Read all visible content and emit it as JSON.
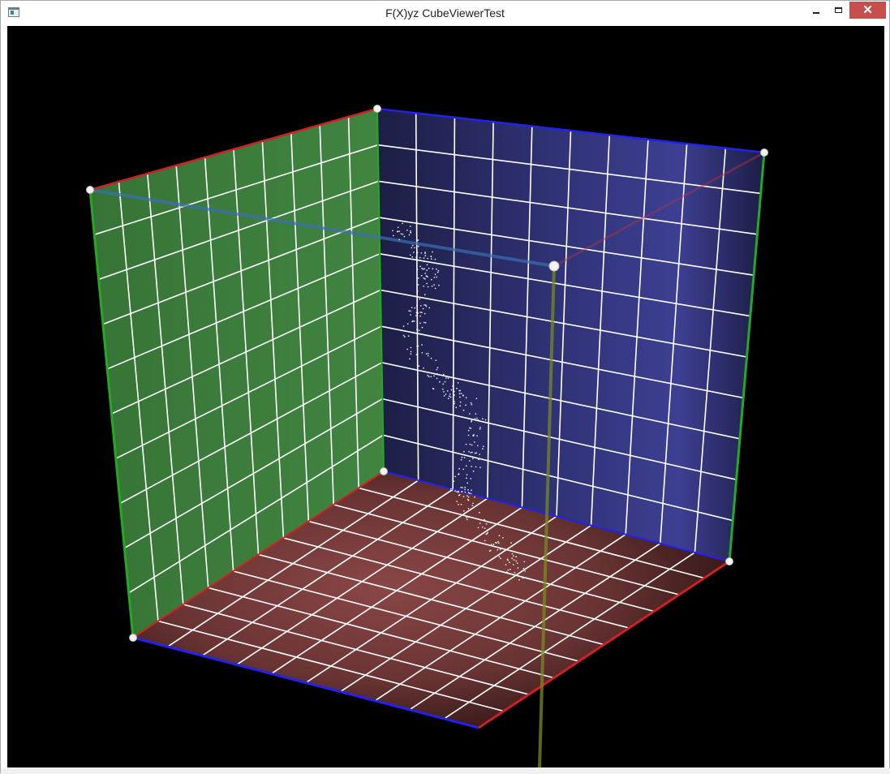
{
  "window": {
    "title": "F(X)yz CubeViewerTest",
    "icon": "app-window-icon",
    "controls": {
      "minimize_icon": "minimize-icon",
      "maximize_icon": "maximize-icon",
      "close_icon": "close-icon"
    }
  },
  "viewer": {
    "grid_divisions": 10,
    "colors": {
      "left_wall": "#3f823f",
      "back_wall": "#2d2f6a",
      "floor": "#6b3535",
      "grid_line": "#ffffff",
      "edge_red": "#cc2222",
      "edge_green": "#22aa22",
      "edge_blue": "#2222ee",
      "background": "#000000"
    }
  }
}
